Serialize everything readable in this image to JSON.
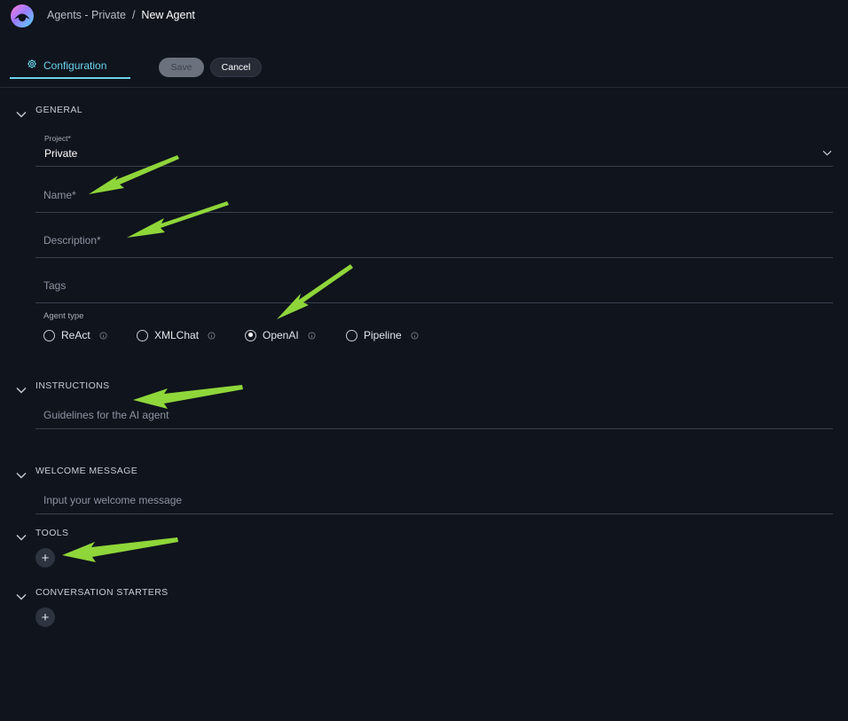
{
  "header": {
    "breadcrumb_parent": "Agents - Private",
    "breadcrumb_separator": "/",
    "breadcrumb_current": "New Agent"
  },
  "tabs": {
    "configuration": "Configuration"
  },
  "toolbar": {
    "save_label": "Save",
    "cancel_label": "Cancel"
  },
  "general": {
    "title": "GENERAL",
    "project_label": "Project*",
    "project_value": "Private",
    "name_placeholder": "Name*",
    "description_placeholder": "Description*",
    "tags_placeholder": "Tags",
    "agent_type_label": "Agent type",
    "agent_types": [
      "ReAct",
      "XMLChat",
      "OpenAI",
      "Pipeline"
    ],
    "agent_type_selected": "OpenAI"
  },
  "instructions": {
    "title": "INSTRUCTIONS",
    "placeholder": "Guidelines for the AI agent"
  },
  "welcome": {
    "title": "WELCOME MESSAGE",
    "placeholder": "Input your welcome message"
  },
  "tools": {
    "title": "TOOLS",
    "add_label": "+"
  },
  "starters": {
    "title": "CONVERSATION STARTERS",
    "add_label": "+"
  },
  "colors": {
    "background": "#10141d",
    "accent": "#6ad5ec",
    "annotation_arrow": "#8fd63a"
  },
  "icons": {
    "logo": "app-logo-icon",
    "tab": "gear-icon",
    "collapse": "chevron-down-icon",
    "info": "info-icon"
  }
}
